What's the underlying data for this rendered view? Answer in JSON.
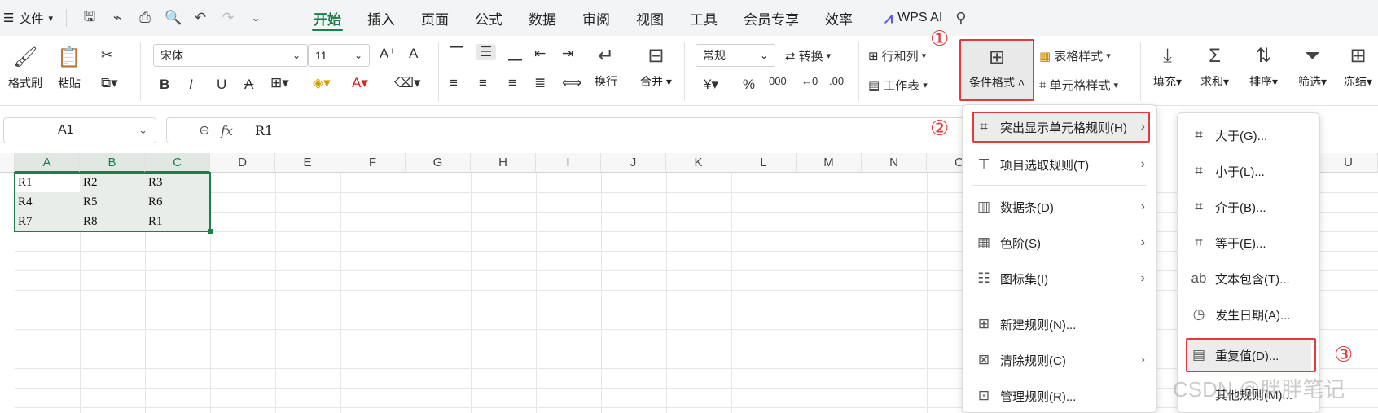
{
  "menubar": {
    "file_label": "文件",
    "tabs": [
      "开始",
      "插入",
      "页面",
      "公式",
      "数据",
      "审阅",
      "视图",
      "工具",
      "会员专享",
      "效率"
    ],
    "active_tab": "开始",
    "wps_ai": "WPS AI"
  },
  "ribbon": {
    "format_painter": "格式刷",
    "paste": "粘贴",
    "font_name": "宋体",
    "font_size": "11",
    "wrap": "换行",
    "merge": "合并",
    "number_format": "常规",
    "convert": "转换",
    "rows_cols": "行和列",
    "worksheet": "工作表",
    "conditional_format": "条件格式",
    "table_style": "表格样式",
    "cell_style": "单元格样式",
    "fill": "填充",
    "sum": "求和",
    "sort": "排序",
    "filter": "筛选",
    "freeze": "冻结"
  },
  "formula_bar": {
    "name_box": "A1",
    "fx": "fx",
    "value": "R1"
  },
  "grid": {
    "columns": [
      "A",
      "B",
      "C",
      "D",
      "E",
      "F",
      "G",
      "H",
      "I",
      "J",
      "K",
      "L",
      "M",
      "N",
      "O",
      "U"
    ],
    "cells": [
      [
        "R1",
        "R2",
        "R3"
      ],
      [
        "R4",
        "R5",
        "R6"
      ],
      [
        "R7",
        "R8",
        "R1"
      ]
    ]
  },
  "menu_main": {
    "items": [
      "突出显示单元格规则(H)",
      "项目选取规则(T)",
      "数据条(D)",
      "色阶(S)",
      "图标集(I)",
      "新建规则(N)...",
      "清除规则(C)",
      "管理规则(R)..."
    ]
  },
  "menu_sub": {
    "items": [
      "大于(G)...",
      "小于(L)...",
      "介于(B)...",
      "等于(E)...",
      "文本包含(T)...",
      "发生日期(A)...",
      "重复值(D)...",
      "其他规则(M)..."
    ]
  },
  "annotations": {
    "step1": "①",
    "step2": "②",
    "step3": "③"
  },
  "watermark": "CSDN @胖胖笔记",
  "colors": {
    "accent": "#1a7f4b",
    "highlight_red": "#e23b3b"
  }
}
